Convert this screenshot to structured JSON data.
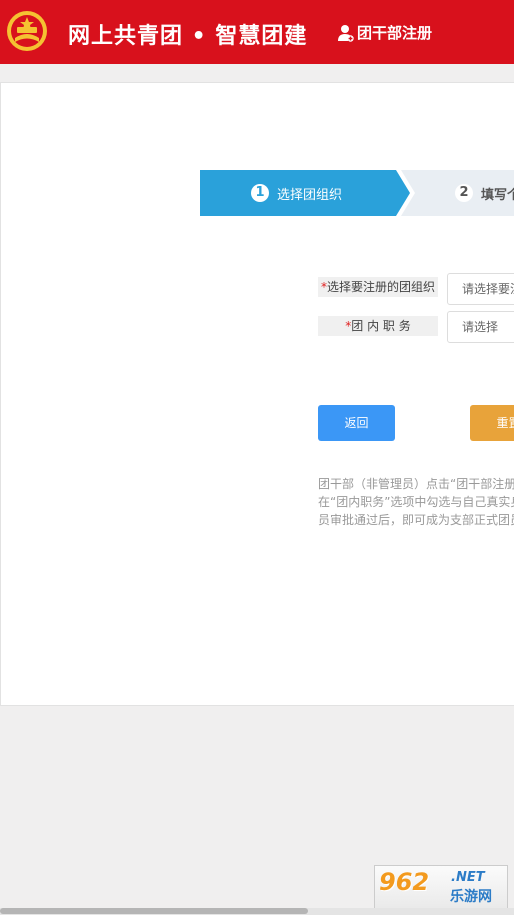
{
  "header": {
    "title": "网上共青团 • 智慧团建",
    "register_link": "团干部注册",
    "background_color": "#d8111c"
  },
  "steps": [
    {
      "number": "1",
      "label": "选择团组织",
      "active": true
    },
    {
      "number": "2",
      "label": "填写个",
      "active": false
    }
  ],
  "form": {
    "org_label_required": "*",
    "org_label": "选择要注册的团组织",
    "org_input_placeholder": "请选择要注",
    "position_label_required": "*",
    "position_label": "团 内 职 务",
    "position_select_value": "请选择"
  },
  "buttons": {
    "back": "返回",
    "reset": "重置"
  },
  "notice": {
    "lines": [
      "团干部（非管理员）点击“团干部注册”",
      "在“团内职务”选项中勾选与自己真实身",
      "员审批通过后，即可成为支部正式团员"
    ]
  },
  "watermark": {
    "number": "962",
    "domain": ".NET",
    "name": "乐游网"
  },
  "colors": {
    "step_active": "#2aa1da",
    "back_button": "#3b97f6",
    "reset_button": "#e8a33a",
    "required_mark": "#e02020"
  }
}
